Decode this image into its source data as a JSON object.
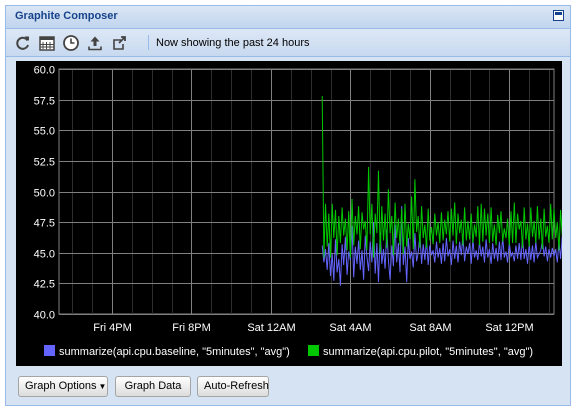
{
  "window": {
    "title": "Graphite Composer"
  },
  "toolbar": {
    "status": "Now showing the past 24 hours",
    "buttons": [
      "refresh-icon",
      "calendar-icon",
      "clock-icon",
      "upload-icon",
      "share-icon"
    ]
  },
  "buttons": {
    "graph_options": "Graph Options",
    "graph_data": "Graph Data",
    "auto_refresh": "Auto-Refresh"
  },
  "colors": {
    "background": "#000000",
    "grid": "#808080",
    "axis_text": "#ffffff",
    "series_baseline": "#6464ff",
    "series_pilot": "#00c800"
  },
  "chart_data": {
    "type": "line",
    "title": "",
    "xlabel": "",
    "ylabel": "",
    "ylim": [
      40.0,
      60.0
    ],
    "yticks": [
      "40.0",
      "42.5",
      "45.0",
      "47.5",
      "50.0",
      "52.5",
      "55.0",
      "57.5",
      "60.0"
    ],
    "xlim": [
      "Fri 1:20PM",
      "Sat 2:15PM"
    ],
    "xticks": [
      "Fri 4PM",
      "Fri 8PM",
      "Sat 12AM",
      "Sat 4AM",
      "Sat 8AM",
      "Sat 12PM"
    ],
    "grid": true,
    "legend_position": "bottom",
    "series": [
      {
        "name": "summarize(api.cpu.baseline, \"5minutes\", \"avg\")",
        "color": "#6464ff",
        "x_start": "Sat 2:35AM",
        "x_step_minutes": 5,
        "values": [
          45.6,
          44.2,
          45.3,
          43.6,
          45.8,
          43.1,
          44.9,
          42.7,
          46.1,
          43.4,
          44.5,
          42.3,
          45.7,
          44.0,
          46.3,
          43.2,
          45.1,
          44.4,
          47.2,
          43.0,
          45.5,
          44.1,
          46.0,
          43.6,
          45.2,
          42.8,
          46.4,
          44.7,
          43.5,
          45.9,
          44.2,
          47.5,
          43.3,
          45.8,
          42.6,
          46.7,
          44.1,
          45.3,
          43.7,
          46.9,
          44.4,
          42.8,
          45.6,
          43.9,
          47.3,
          44.2,
          45.8,
          43.4,
          48.8,
          44.0,
          45.5,
          42.6,
          46.2,
          44.5,
          45.1,
          43.8,
          46.6,
          44.3,
          45.0,
          46.5,
          44.1,
          45.7,
          44.4,
          46.1,
          44.0,
          45.6,
          44.8,
          45.2,
          44.2,
          45.9,
          44.6,
          45.4,
          44.1,
          45.8,
          44.3,
          46.2,
          44.7,
          45.3,
          44.0,
          46.0,
          44.5,
          45.6,
          44.2,
          45.9,
          44.8,
          46.4,
          44.3,
          45.5,
          44.9,
          45.8,
          44.1,
          46.1,
          44.6,
          45.2,
          44.4,
          45.9,
          44.7,
          45.5,
          44.2,
          46.1,
          44.6,
          45.3,
          44.1,
          45.8,
          44.5,
          45.4,
          44.3,
          45.9,
          44.4,
          46.3,
          44.6,
          45.1,
          44.2,
          45.8,
          44.7,
          45.0,
          44.3,
          45.6,
          44.5,
          45.8,
          44.4,
          46.2,
          44.5,
          45.3,
          44.1,
          45.7,
          44.4,
          45.6,
          44.2,
          45.9,
          44.6,
          44.9,
          45.2,
          46.0,
          44.7,
          45.5,
          44.3,
          45.3,
          44.6,
          45.4,
          44.7,
          45.3,
          44.2,
          45.9,
          44.5,
          46.4,
          44.2,
          45.4,
          44.9,
          45.7,
          45.1,
          46.0,
          44.1,
          45.5,
          44.4,
          45.3,
          44.6,
          45.6,
          44.9,
          45.1,
          44.5,
          45.6,
          44.3,
          45.2,
          44.8,
          45.0,
          46.0,
          43.6
        ]
      },
      {
        "name": "summarize(api.cpu.pilot, \"5minutes\", \"avg\")",
        "color": "#00c800",
        "x_start": "Sat 2:35AM",
        "x_step_minutes": 5,
        "values": [
          57.8,
          44.6,
          49.0,
          45.5,
          48.2,
          44.6,
          49.0,
          46.2,
          48.5,
          44.8,
          48.0,
          45.8,
          48.7,
          46.4,
          47.8,
          45.2,
          48.4,
          44.6,
          49.4,
          45.6,
          48.0,
          46.5,
          48.8,
          45.3,
          48.3,
          46.9,
          47.6,
          45.2,
          52.0,
          46.5,
          49.0,
          44.6,
          48.2,
          46.6,
          51.7,
          45.0,
          48.8,
          46.0,
          48.2,
          45.4,
          50.2,
          46.6,
          48.0,
          44.8,
          49.1,
          46.2,
          47.8,
          45.6,
          48.6,
          44.9,
          49.0,
          45.5,
          47.4,
          46.1,
          49.6,
          45.3,
          51.0,
          46.7,
          48.0,
          45.4,
          48.8,
          46.2,
          47.3,
          45.4,
          48.6,
          46.0,
          47.1,
          45.7,
          48.2,
          46.4,
          47.5,
          45.8,
          48.3,
          46.0,
          47.7,
          46.5,
          48.4,
          45.9,
          48.6,
          46.4,
          49.1,
          45.7,
          48.2,
          46.6,
          47.7,
          45.6,
          48.7,
          46.0,
          47.6,
          46.1,
          48.2,
          45.8,
          47.3,
          46.3,
          48.8,
          45.6,
          49.0,
          45.9,
          48.6,
          46.4,
          48.2,
          45.8,
          48.7,
          45.9,
          47.3,
          45.6,
          48.1,
          46.6,
          48.4,
          45.9,
          47.0,
          46.2,
          47.8,
          45.6,
          48.4,
          45.8,
          49.1,
          45.8,
          48.2,
          46.9,
          47.6,
          45.4,
          48.7,
          46.1,
          47.4,
          45.5,
          48.7,
          46.3,
          47.6,
          45.8,
          48.8,
          46.1,
          47.8,
          45.3,
          48.6,
          46.3,
          47.2,
          45.8,
          49.0,
          46.1,
          48.6,
          46.2,
          47.5,
          45.2,
          48.5,
          46.4,
          47.5,
          45.5,
          48.8,
          46.0,
          47.6,
          46.8,
          47.9,
          45.2,
          49.3,
          46.4,
          48.2,
          45.9,
          47.8,
          46.3,
          48.6,
          45.6,
          47.5,
          46.4,
          48.7,
          46.1,
          47.3,
          46.8
        ]
      }
    ]
  }
}
